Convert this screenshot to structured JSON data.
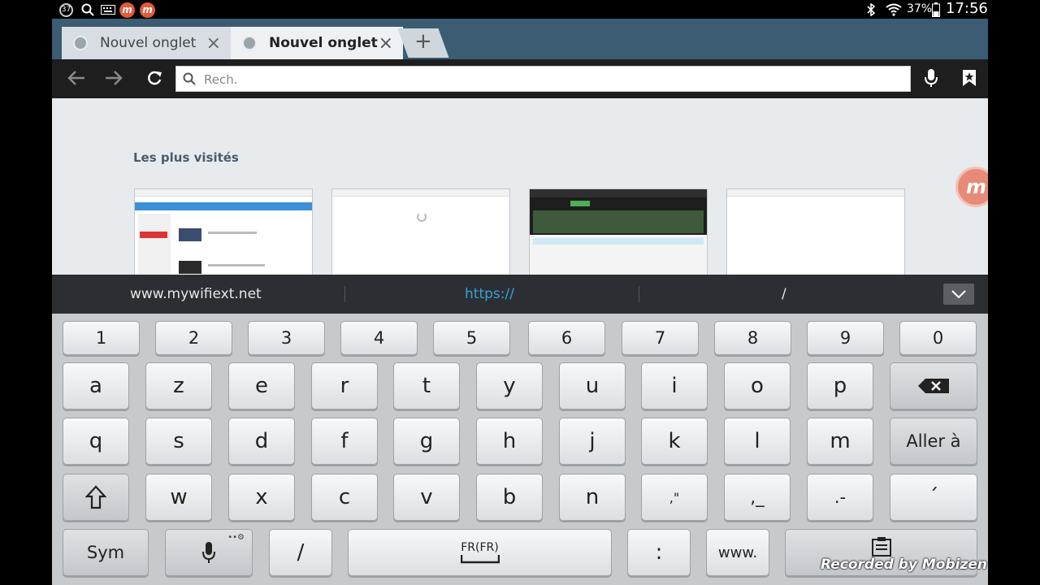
{
  "status_bar": {
    "notification_badge": "37",
    "battery_percent": "37%",
    "clock": "17:56"
  },
  "tabs": [
    {
      "title": "Nouvel onglet"
    },
    {
      "title": "Nouvel onglet"
    }
  ],
  "new_tab_label": "+",
  "toolbar": {
    "url_placeholder": "Rech."
  },
  "page": {
    "most_visited_title": "Les plus visités"
  },
  "suggestions": [
    "www.mywifiext.net",
    "https://",
    "/"
  ],
  "keyboard": {
    "row_numbers": [
      "1",
      "2",
      "3",
      "4",
      "5",
      "6",
      "7",
      "8",
      "9",
      "0"
    ],
    "row_1": [
      "a",
      "z",
      "e",
      "r",
      "t",
      "y",
      "u",
      "i",
      "o",
      "p"
    ],
    "row_2": [
      "q",
      "s",
      "d",
      "f",
      "g",
      "h",
      "j",
      "k",
      "l",
      "m"
    ],
    "row_3": [
      "w",
      "x",
      "c",
      "v",
      "b",
      "n",
      ",\"",
      ",_",
      ".-",
      "´"
    ],
    "enter_label": "Aller à",
    "sym_label": "Sym",
    "slash_label": "/",
    "language_label": "FR(FR)",
    "colon_label": ":",
    "www_label": "www."
  },
  "watermark": "Recorded by Mobizen",
  "colors": {
    "tab_strip": "#3b5c73",
    "toolbar": "#1e1e1e",
    "suggest_accent": "#3aa0d8",
    "keyboard_bg": "#c7cacd"
  }
}
